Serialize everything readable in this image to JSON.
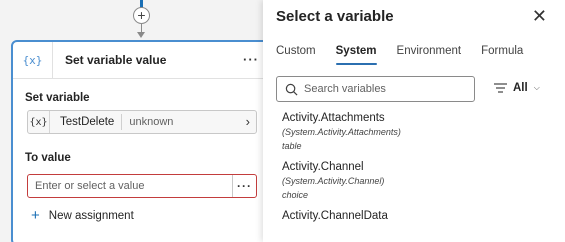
{
  "node": {
    "icon_text": "{x}",
    "title": "Set variable value",
    "more_label": "···",
    "set_variable_label": "Set variable",
    "variable": {
      "glyph": "{x}",
      "name": "TestDelete",
      "type": "unknown"
    },
    "to_value_label": "To value",
    "value_placeholder": "Enter or select a value",
    "value_more_label": "···",
    "new_assignment_label": "New assignment"
  },
  "panel": {
    "title": "Select a variable",
    "close_glyph": "✕",
    "tabs": [
      {
        "label": "Custom"
      },
      {
        "label": "System"
      },
      {
        "label": "Environment"
      },
      {
        "label": "Formula"
      }
    ],
    "active_tab": "System",
    "search_placeholder": "Search variables",
    "filter_label": "All",
    "variables": [
      {
        "name": "Activity.Attachments",
        "path": "(System.Activity.Attachments)",
        "type": "table"
      },
      {
        "name": "Activity.Channel",
        "path": "(System.Activity.Channel)",
        "type": "choice"
      },
      {
        "name": "Activity.ChannelData",
        "path": "",
        "type": ""
      }
    ]
  },
  "colors": {
    "accent": "#2b6fb0",
    "node_border": "#4a8ed0",
    "error_border": "#c33d3d"
  },
  "icons": {
    "add_node": "plus-icon",
    "close": "close-icon",
    "search": "search-icon",
    "filter": "filter-icon",
    "chevron": "chevron-right-icon"
  }
}
